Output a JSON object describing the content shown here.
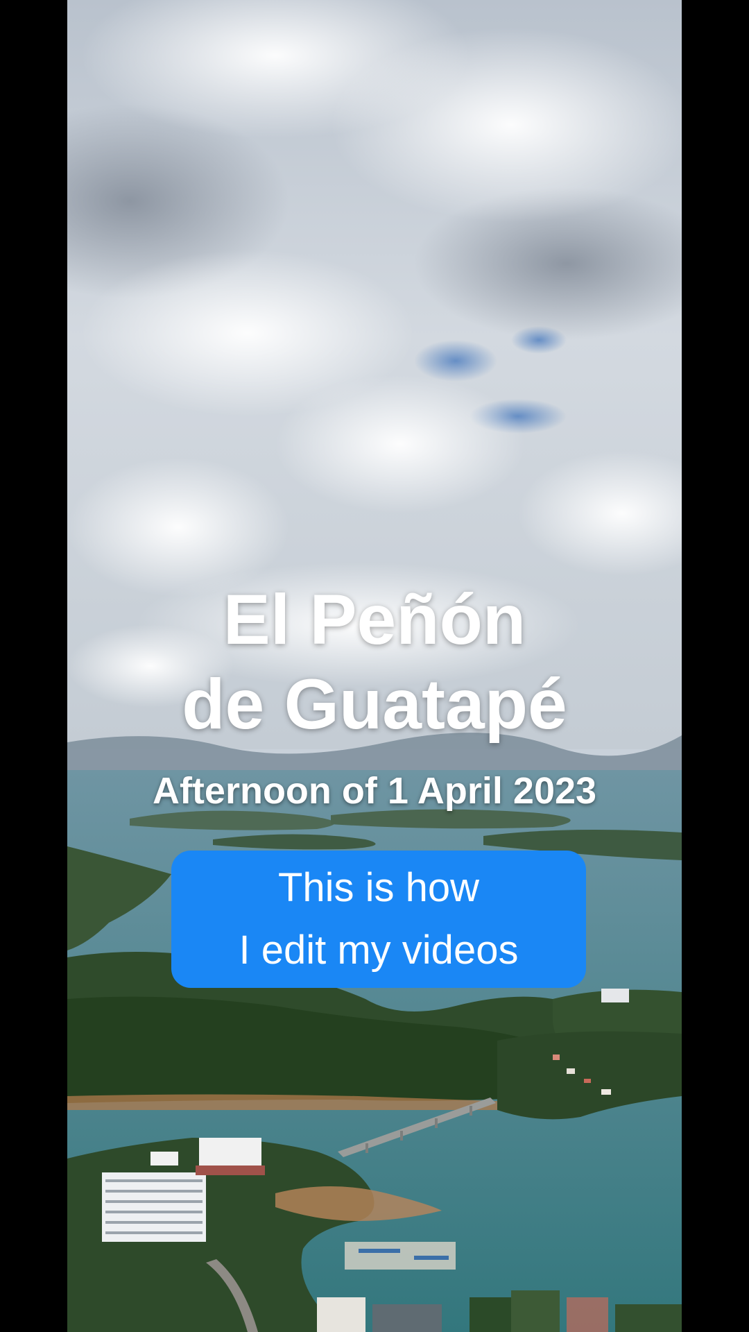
{
  "overlay": {
    "title_line1": "El Peñón",
    "title_line2": "de Guatapé",
    "subtitle": "Afternoon of 1 April 2023",
    "cta_line1": "This is how",
    "cta_line2": "I edit my videos"
  },
  "colors": {
    "cta_background": "#1a87f5",
    "text": "#ffffff",
    "letterbox": "#000000",
    "sky": "#c9d1da",
    "water": "#3f7d86",
    "forest": "#2e4a2a"
  },
  "scene": "aerial-lake-landscape-photo"
}
